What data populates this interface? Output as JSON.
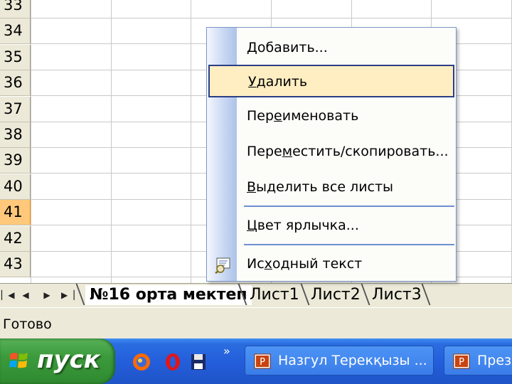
{
  "sheet": {
    "rows": [
      "33",
      "34",
      "35",
      "36",
      "37",
      "38",
      "39",
      "40",
      "41",
      "42",
      "43"
    ],
    "active_row": "41"
  },
  "context_menu": {
    "items": [
      {
        "label": "Добавить...",
        "underline": 0
      },
      {
        "label": "Удалить",
        "underline": 0,
        "highlighted": true
      },
      {
        "label": "Переименовать",
        "underline": 3
      },
      {
        "label": "Переместить/скопировать...",
        "underline": 4
      },
      {
        "label": "Выделить все листы",
        "underline": 0
      },
      {
        "label": "Цвет ярлычка...",
        "underline": 0
      },
      {
        "label": "Исходный текст",
        "underline": 2,
        "icon": "view-code-icon"
      }
    ]
  },
  "sheet_tabs": {
    "active": "№16 орта мектеп",
    "others": [
      "Лист1",
      "Лист2",
      "Лист3"
    ]
  },
  "status_bar": {
    "text": "Готово"
  },
  "taskbar": {
    "start_label": "пуск",
    "quick_launch": [
      "firefox-icon",
      "opera-icon",
      "save-disk-icon"
    ],
    "chevron": "»",
    "buttons": [
      "Назгул Терекқызы ...",
      "Презе"
    ]
  },
  "colors": {
    "active_row_header": "#ffc87a",
    "menu_highlight": "#ffeec2",
    "menu_highlight_border": "#2a3f86",
    "taskbar_blue": "#245edb",
    "start_green": "#3c9a3c"
  }
}
